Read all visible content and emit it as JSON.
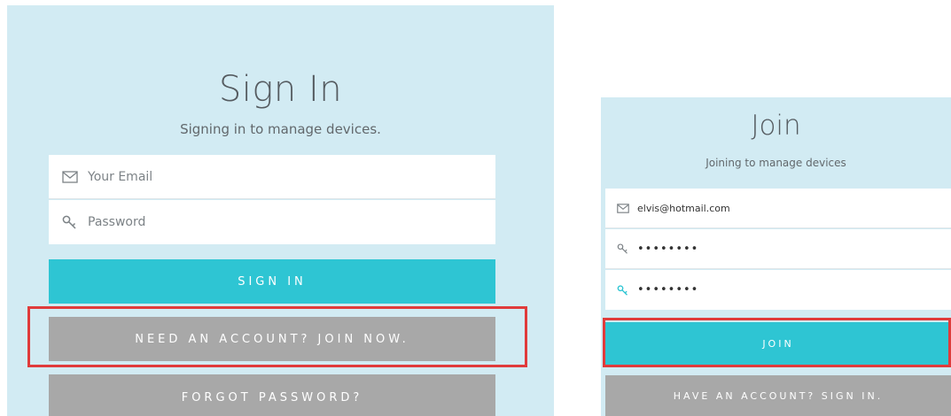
{
  "colors": {
    "panel_bg": "#d2ebf3",
    "primary_button": "#2ec5d3",
    "secondary_button": "#a8a8a8",
    "highlight": "#e03b3b",
    "active_icon": "#2ec5d3"
  },
  "signin": {
    "title": "Sign In",
    "subtitle": "Signing in to manage devices.",
    "email_placeholder": "Your Email",
    "email_icon": "envelope-icon",
    "password_placeholder": "Password",
    "password_icon": "key-icon",
    "signin_label": "SIGN IN",
    "join_label": "NEED AN ACCOUNT? JOIN NOW.",
    "forgot_label": "FORGOT PASSWORD?"
  },
  "join": {
    "title": "Join",
    "subtitle": "Joining to manage devices",
    "email_value": "elvis@hotmail.com",
    "email_icon": "envelope-icon",
    "password_value": "••••••••",
    "password_icon": "key-icon",
    "confirm_value": "••••••••",
    "confirm_icon": "key-icon",
    "join_label": "JOIN",
    "signin_label": "HAVE AN ACCOUNT? SIGN IN."
  }
}
